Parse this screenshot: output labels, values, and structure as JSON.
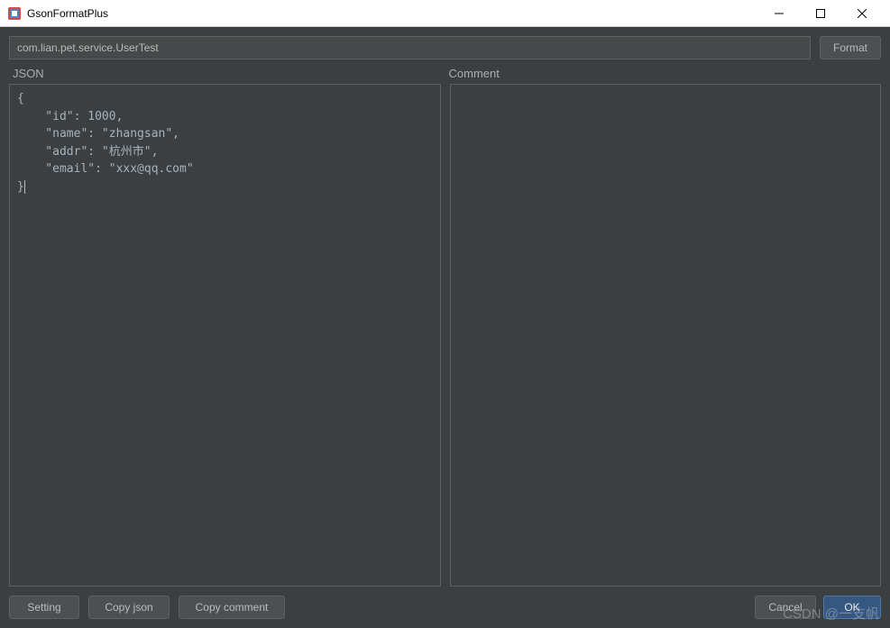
{
  "window": {
    "title": "GsonFormatPlus"
  },
  "toolbar": {
    "class_path": "com.lian.pet.service.UserTest",
    "format_label": "Format"
  },
  "labels": {
    "json": "JSON",
    "comment": "Comment"
  },
  "json_content": "{\n    \"id\": 1000,\n    \"name\": \"zhangsan\",\n    \"addr\": \"杭州市\",\n    \"email\": \"xxx@qq.com\"\n}",
  "comment_content": "",
  "buttons": {
    "setting": "Setting",
    "copy_json": "Copy  json",
    "copy_comment": "Copy comment",
    "cancel": "Cancel",
    "ok": "OK"
  },
  "watermark": "CSDN @一支帆"
}
